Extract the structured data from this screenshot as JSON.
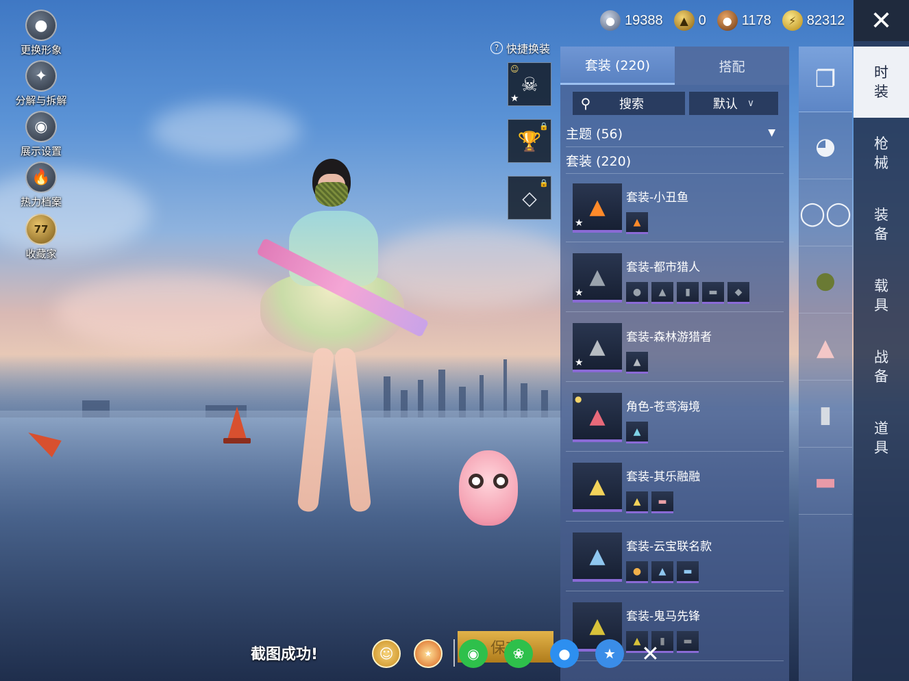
{
  "left_menu": [
    {
      "label": "更换形象",
      "icon": "person-icon"
    },
    {
      "label": "分解与拆解",
      "icon": "puzzle-icon"
    },
    {
      "label": "展示设置",
      "icon": "eye-icon"
    },
    {
      "label": "热力档案",
      "icon": "flame-icon"
    },
    {
      "label": "收藏家",
      "icon": "collector-badge-icon",
      "badge": "77"
    }
  ],
  "currencies": [
    {
      "value": "19388",
      "icon": "silver-coin-icon",
      "color": "#7d8fb0"
    },
    {
      "value": "0",
      "icon": "gold-emblem-icon",
      "color": "#d9a52a"
    },
    {
      "value": "1178",
      "icon": "bronze-coin-icon",
      "color": "#b56a2a"
    },
    {
      "value": "82312",
      "icon": "bp-coin-icon",
      "color": "#e3c23a"
    }
  ],
  "quick_swap": {
    "label": "快捷换装"
  },
  "tabs": [
    {
      "label": "套装 (220)",
      "active": true
    },
    {
      "label": "搭配",
      "active": false
    }
  ],
  "search": {
    "label": "搜索",
    "sort": "默认"
  },
  "filters": {
    "theme": "主题 (56)",
    "suits": "套装 (220)"
  },
  "items": [
    {
      "title": "套装-小丑鱼",
      "chips": 1,
      "starred": true
    },
    {
      "title": "套装-都市猎人",
      "chips": 5,
      "starred": true
    },
    {
      "title": "套装-森林游猎者",
      "chips": 1,
      "starred": true
    },
    {
      "title": "角色-苍鸢海境",
      "chips": 1,
      "starred": false
    },
    {
      "title": "套装-其乐融融",
      "chips": 2,
      "starred": false
    },
    {
      "title": "套装-云宝联名款",
      "chips": 3,
      "starred": false
    },
    {
      "title": "套装-鬼马先锋",
      "chips": 3,
      "starred": false
    }
  ],
  "categories": [
    {
      "icon": "outfit-box-icon",
      "active": true
    },
    {
      "icon": "cap-icon",
      "active": false
    },
    {
      "icon": "glasses-icon",
      "active": false
    },
    {
      "icon": "mask-icon",
      "active": false
    },
    {
      "icon": "shirt-icon",
      "active": false
    },
    {
      "icon": "pants-icon",
      "active": false
    },
    {
      "icon": "shoes-icon",
      "active": false
    }
  ],
  "side_tabs": [
    {
      "label": "时装",
      "active": true
    },
    {
      "label": "枪械",
      "active": false
    },
    {
      "label": "装备",
      "active": false
    },
    {
      "label": "载具",
      "active": false
    },
    {
      "label": "战备",
      "active": false
    },
    {
      "label": "道具",
      "active": false
    }
  ],
  "bottom": {
    "toast": "截图成功!",
    "save_label": "保存",
    "share_icons": [
      "gift-share-icon",
      "peace-elite-icon",
      "wechat-icon",
      "moments-icon",
      "qq-icon",
      "qzone-icon"
    ]
  }
}
